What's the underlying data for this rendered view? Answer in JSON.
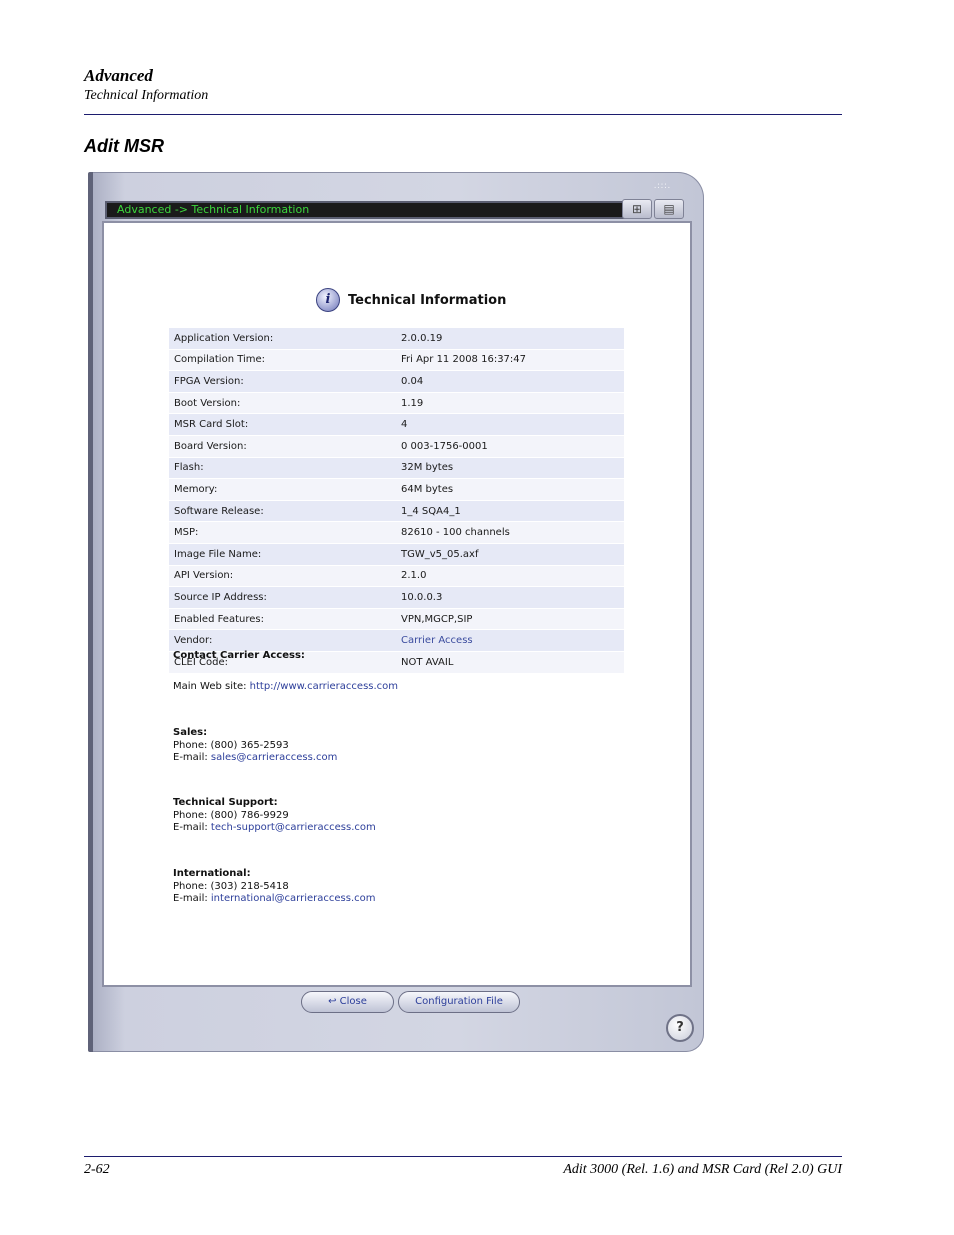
{
  "header": {
    "chapter": "Advanced",
    "section": "Technical Information"
  },
  "section_title": "Adit MSR",
  "window": {
    "breadcrumb": "Advanced -> Technical Information",
    "grip_glyph": ".:::.",
    "tree_icon": "⊞",
    "list_icon": "▤",
    "help_glyph": "?"
  },
  "panel": {
    "icon_glyph": "i",
    "title": "Technical Information",
    "rows": [
      {
        "label": "Application Version:",
        "value": "2.0.0.19"
      },
      {
        "label": "Compilation Time:",
        "value": "Fri Apr 11 2008 16:37:47"
      },
      {
        "label": "FPGA Version:",
        "value": "0.04"
      },
      {
        "label": "Boot Version:",
        "value": "1.19"
      },
      {
        "label": "MSR Card Slot:",
        "value": "4"
      },
      {
        "label": "Board Version:",
        "value": "0 003-1756-0001"
      },
      {
        "label": "Flash:",
        "value": "32M bytes"
      },
      {
        "label": "Memory:",
        "value": "64M bytes"
      },
      {
        "label": "Software Release:",
        "value": "1_4 SQA4_1"
      },
      {
        "label": "MSP:",
        "value": "82610 - 100 channels"
      },
      {
        "label": "Image File Name:",
        "value": "TGW_v5_05.axf"
      },
      {
        "label": "API Version:",
        "value": "2.1.0"
      },
      {
        "label": "Source IP Address:",
        "value": "10.0.0.3"
      },
      {
        "label": "Enabled Features:",
        "value": "VPN,MGCP,SIP"
      },
      {
        "label": "Vendor:",
        "value": "Carrier Access"
      },
      {
        "label": "CLEI Code:",
        "value": "NOT AVAIL"
      }
    ],
    "contact": {
      "heading": "Contact Carrier Access:",
      "web_label": "Main Web site: ",
      "web_url": "http://www.carrieraccess.com",
      "sales_heading": "Sales:",
      "sales_phone": "Phone: (800) 365-2593",
      "sales_email_label": "E-mail: ",
      "sales_email": "sales@carrieraccess.com",
      "support_heading": "Technical Support:",
      "support_phone": "Phone: (800) 786-9929",
      "support_email_label": "E-mail: ",
      "support_email": "tech-support@carrieraccess.com",
      "intl_heading": "International:",
      "intl_phone": "Phone: (303) 218-5418",
      "intl_email_label": "E-mail: ",
      "intl_email": "international@carrieraccess.com"
    },
    "buttons": {
      "close_icon": "↩",
      "close": "Close",
      "config": "Configuration File"
    }
  },
  "footer": {
    "page": "2-62",
    "doc": "Adit 3000 (Rel. 1.6) and MSR Card (Rel 2.0) GUI"
  }
}
